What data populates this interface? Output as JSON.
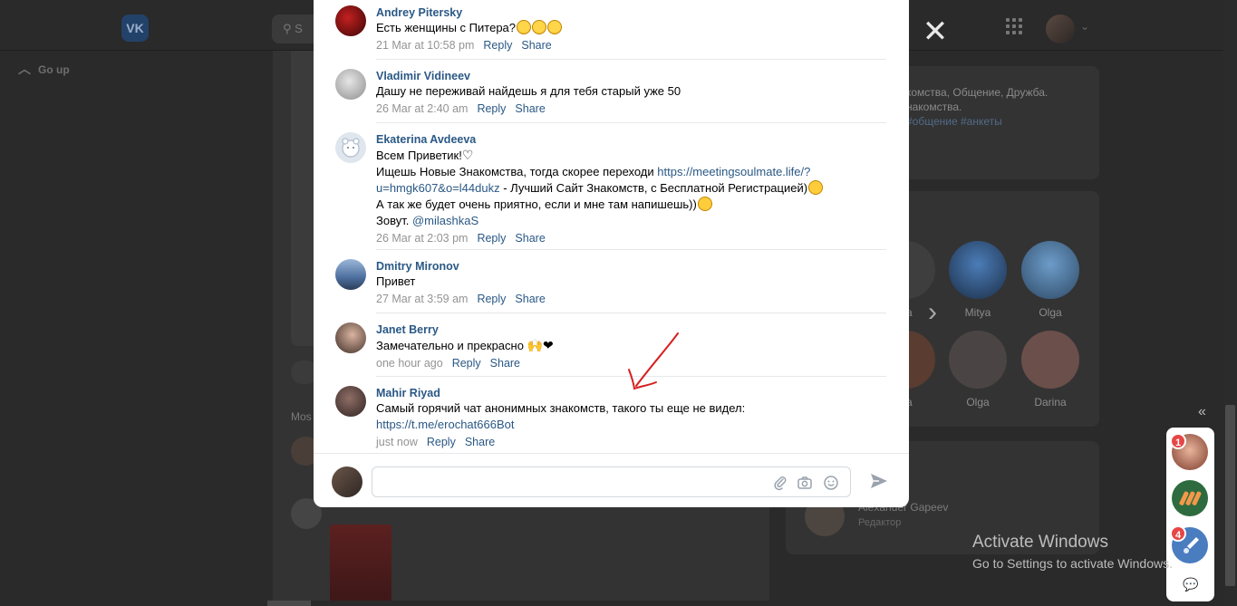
{
  "background": {
    "logo": "VK",
    "search_fragment": "S",
    "go_up": "Go up",
    "most_fragment": "Mos",
    "group_info": {
      "line1": "комства, Общение, Дружба.",
      "line2": "накомства.",
      "tags": "#общение #анкеты"
    },
    "friends": [
      {
        "name": "na"
      },
      {
        "name": "Mitya"
      },
      {
        "name": "Olga"
      },
      {
        "name": "na"
      },
      {
        "name": "Olga"
      },
      {
        "name": "Darina"
      }
    ],
    "editor": {
      "name": "Alexander Gapeev",
      "role": "Редактор"
    }
  },
  "comments": [
    {
      "author": "Andrey Pitersky",
      "text": "Есть женщины с Питера?",
      "time": "21 Mar at 10:58 pm",
      "avatar_color": "#8b1e1e"
    },
    {
      "author": "Vladimir Vidineev",
      "text": "Дашу не переживай найдешь я для тебя старый уже 50",
      "time": "26 Mar at 2:40 am",
      "avatar_color": "#c9c9c9"
    },
    {
      "author": "Ekaterina Avdeeva",
      "line1": "Всем Приветик!",
      "line2_pre": "Ищешь Новые Знакомства, тогда скорее переходи ",
      "link1": "https://meetingsoulmate.life/?u=hmgk607&o=l44dukz",
      "line2_post": " - Лучший Сайт Знакомств, с Бесплатной Регистрацией)",
      "line3": "А так же будет очень приятно, если и мне там напишешь))",
      "line4_pre": "Зовут. ",
      "mention": "@milashkaS",
      "time": "26 Mar at 2:03 pm",
      "avatar_color": "#dfe6ee"
    },
    {
      "author": "Dmitry Mironov",
      "text": "Привет",
      "time": "27 Mar at 3:59 am",
      "avatar_color": "#5b7aa8"
    },
    {
      "author": "Janet Berry",
      "text": "Замечательно и прекрасно ",
      "time": "one hour ago",
      "avatar_color": "#6b5a50"
    },
    {
      "author": "Mahir Riyad",
      "text": "Самый горячий чат анонимных знакомств, такого ты еще не видел:",
      "link": "https://t.me/erochat666Bot",
      "time": "just now",
      "avatar_color": "#5a4a46"
    }
  ],
  "actions": {
    "reply": "Reply",
    "share": "Share"
  },
  "composer": {
    "placeholder": ""
  },
  "float_panel": {
    "badge1": "1",
    "badge2": "4"
  },
  "watermark": {
    "title": "Activate Windows",
    "subtitle": "Go to Settings to activate Windows."
  },
  "colors": {
    "link": "#2a5885",
    "meta": "#939393",
    "badge": "#e64646"
  }
}
